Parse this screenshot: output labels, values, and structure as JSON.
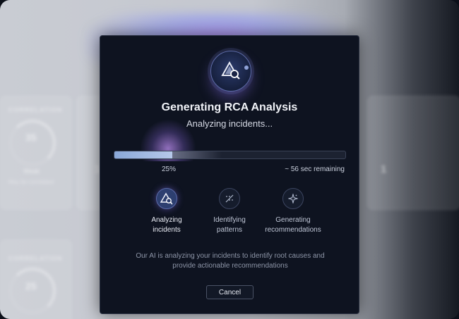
{
  "background": {
    "card_label": "CORRELATION",
    "gauge_values": [
      "35",
      "25"
    ],
    "gauge_caption": "Weak",
    "gauge_subcaption": "May be correlated"
  },
  "modal": {
    "title": "Generating RCA Analysis",
    "subtitle": "Analyzing incidents...",
    "progress_percent": 25,
    "progress_label": "25%",
    "remaining_label": "~ 56 sec remaining",
    "steps": [
      {
        "line1": "Analyzing",
        "line2": "incidents",
        "icon": "prism-search-icon",
        "active": true
      },
      {
        "line1": "Identifying",
        "line2": "patterns",
        "icon": "pattern-icon",
        "active": false
      },
      {
        "line1": "Generating",
        "line2": "recommendations",
        "icon": "sparkle-icon",
        "active": false
      }
    ],
    "info_line1": "Our AI is analyzing your incidents to identify root causes and",
    "info_line2": "provide actionable recommendations",
    "cancel_label": "Cancel"
  },
  "colors": {
    "modal_bg": "#0e1320",
    "accent": "#8aa8d8",
    "glow": "#aa78ff"
  }
}
